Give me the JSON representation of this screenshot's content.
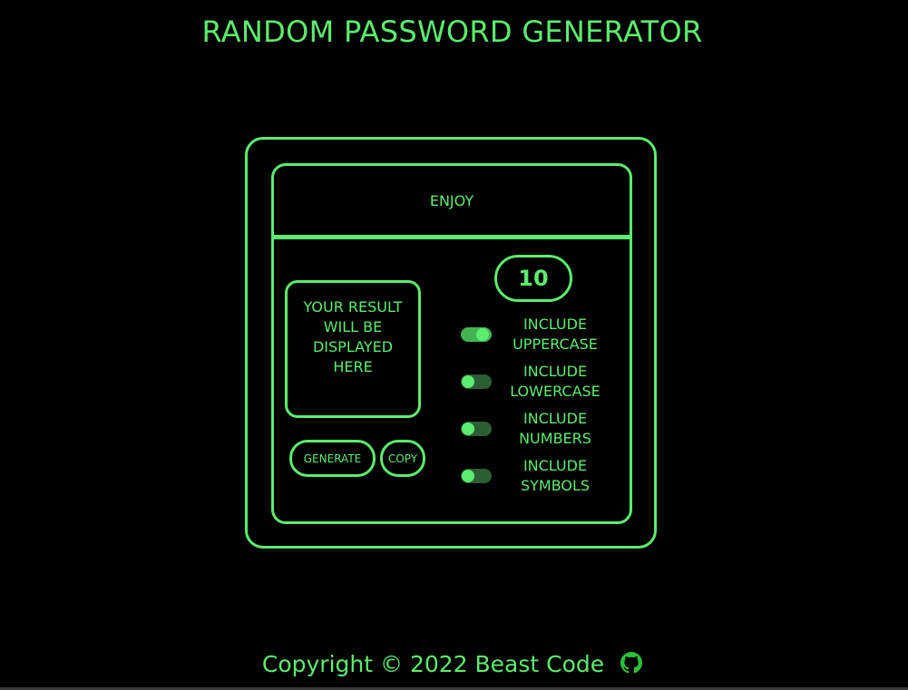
{
  "page_title": "RANDOM PASSWORD GENERATOR",
  "card": {
    "header": "ENJOY",
    "result_placeholder": [
      "YOUR RESULT",
      "WILL BE",
      "DISPLAYED",
      "HERE"
    ],
    "generate_label": "GENERATE",
    "copy_label": "COPY",
    "length_value": "10",
    "options": [
      {
        "line1": "INCLUDE",
        "line2": "UPPERCASE",
        "checked": true
      },
      {
        "line1": "INCLUDE",
        "line2": "LOWERCASE",
        "checked": false
      },
      {
        "line1": "INCLUDE",
        "line2": "NUMBERS",
        "checked": false
      },
      {
        "line1": "INCLUDE",
        "line2": "SYMBOLS",
        "checked": false
      }
    ]
  },
  "footer": {
    "copyright": "Copyright © 2022 Beast Code",
    "icon": "github-icon"
  },
  "colors": {
    "accent": "#5bed6e",
    "background": "#000000"
  }
}
